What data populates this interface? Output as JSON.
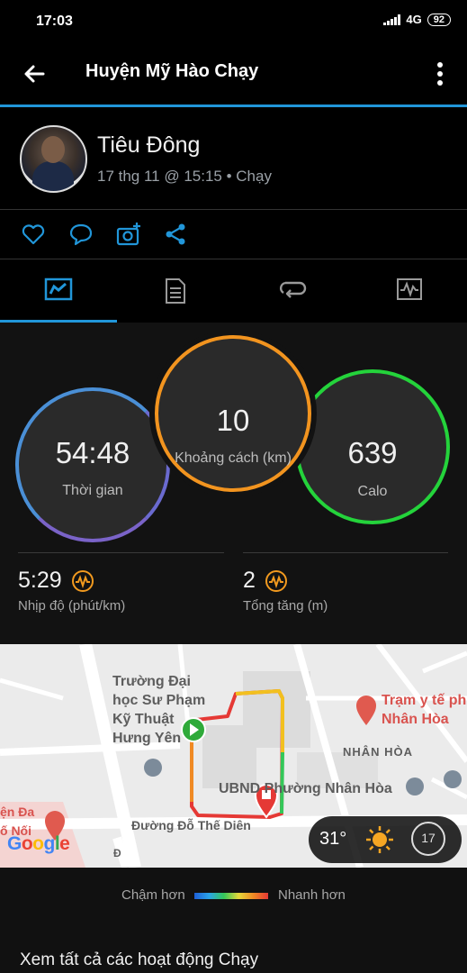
{
  "status_bar": {
    "time": "17:03",
    "network": "4G",
    "battery": "92"
  },
  "app_bar": {
    "title": "Huyện Mỹ Hào Chạy"
  },
  "profile": {
    "name": "Tiêu Đông",
    "meta": "17 thg 11 @ 15:15 • Chạy"
  },
  "actions": [
    {
      "icon": "heart-icon"
    },
    {
      "icon": "comment-icon"
    },
    {
      "icon": "add-photo-icon"
    },
    {
      "icon": "share-icon"
    }
  ],
  "tabs": [
    {
      "icon": "summary-chart-icon",
      "active": true
    },
    {
      "icon": "document-list-icon",
      "active": false
    },
    {
      "icon": "laps-loop-icon",
      "active": false
    },
    {
      "icon": "activity-graph-icon",
      "active": false
    }
  ],
  "stats": {
    "time": {
      "value": "54:48",
      "label": "Thời gian",
      "color": "#4a8fd6"
    },
    "distance": {
      "value": "10",
      "label": "Khoảng cách (km)",
      "color": "#f2941f"
    },
    "calories": {
      "value": "639",
      "label": "Calo",
      "color": "#24d33b"
    },
    "pace": {
      "value": "5:29",
      "label": "Nhịp độ (phút/km)"
    },
    "elevation": {
      "value": "2",
      "label": "Tổng tăng (m)"
    }
  },
  "map": {
    "labels": {
      "university": "Trường Đại\nhọc Sư Phạm\nKỹ Thuật\nHưng Yên",
      "clinic": "Trạm y tế ph\nNhân Hòa",
      "ward": "NHÂN HÒA",
      "ubnd": "UBND Phường Nhân Hòa",
      "street": "Đường Đỗ Thế Diên",
      "left_poi": "ện Đa\nố Nối",
      "road_vertical": "Đ",
      "google": "Google"
    },
    "weather": {
      "temperature": "31°",
      "wind": "17"
    }
  },
  "legend": {
    "slower": "Chậm hơn",
    "faster": "Nhanh hơn"
  },
  "footer": {
    "link": "Xem tất cả các hoạt động Chạy"
  }
}
